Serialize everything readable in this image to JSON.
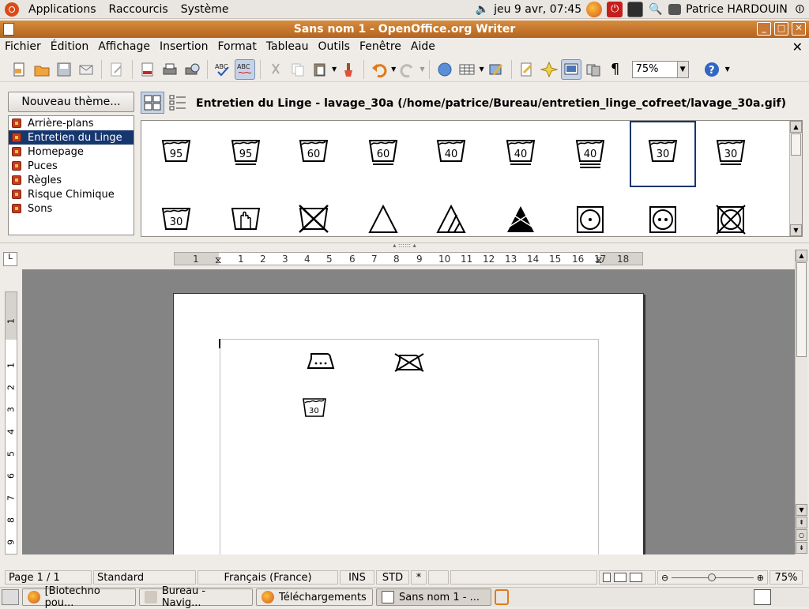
{
  "topbar": {
    "menus": [
      "Applications",
      "Raccourcis",
      "Système"
    ],
    "clock": "jeu  9 avr, 07:45",
    "user": "Patrice HARDOUIN"
  },
  "window": {
    "title": "Sans nom 1 - OpenOffice.org Writer"
  },
  "menubar": [
    "Fichier",
    "Édition",
    "Affichage",
    "Insertion",
    "Format",
    "Tableau",
    "Outils",
    "Fenêtre",
    "Aide"
  ],
  "toolbar": {
    "zoom": "75%"
  },
  "gallery": {
    "new_theme_label": "Nouveau thème...",
    "themes": [
      "Arrière-plans",
      "Entretien du Linge",
      "Homepage",
      "Puces",
      "Règles",
      "Risque Chimique",
      "Sons"
    ],
    "selected_theme_index": 1,
    "title": "Entretien du Linge - lavage_30a (/home/patrice/Bureau/entretien_linge_cofreet/lavage_30a.gif)",
    "row1": [
      "95",
      "95",
      "60",
      "60",
      "40",
      "40",
      "40",
      "30",
      "30"
    ],
    "row1_bars": [
      0,
      1,
      0,
      1,
      0,
      1,
      2,
      0,
      1
    ],
    "selected_cell_index": 7,
    "row2": [
      "30",
      "hand",
      "no-wash",
      "triangle",
      "triangle-lines",
      "no-bleach",
      "dryer-one-dot",
      "dryer-two-dots",
      "no-dryer"
    ]
  },
  "ruler": {
    "h_numbers": [
      "1",
      "1",
      "2",
      "3",
      "4",
      "5",
      "6",
      "7",
      "8",
      "9",
      "10",
      "11",
      "12",
      "13",
      "14",
      "15",
      "16",
      "17",
      "18"
    ],
    "v_numbers": [
      "1",
      "1",
      "2",
      "3",
      "4",
      "5",
      "6",
      "7",
      "8",
      "9"
    ]
  },
  "document": {
    "tub_label": "30"
  },
  "statusbar": {
    "page": "Page 1 / 1",
    "style": "Standard",
    "language": "Français (France)",
    "insert_mode": "INS",
    "selection_mode": "STD",
    "modified": "*",
    "zoom": "75%"
  },
  "taskbar": {
    "tasks": [
      "[Biotechno pou...",
      "Bureau - Navig...",
      "Téléchargements",
      "Sans nom 1 - ..."
    ]
  }
}
